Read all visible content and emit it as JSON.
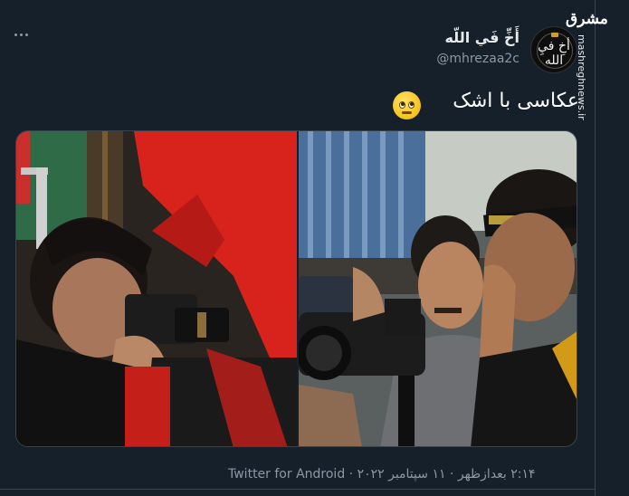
{
  "watermark": {
    "logo_text": "مشرق",
    "url": "mashreghnews.ir"
  },
  "author": {
    "display_name": "أَخِّ فَي اللّه",
    "handle": "@mhrezaa2c",
    "avatar_text": "أخِ فيِ الله"
  },
  "tweet": {
    "text": "عکاسی با اشک",
    "emoji": "pleading-face-emoji"
  },
  "media": {
    "photos": [
      {
        "label": "photographer-crying-left-photo"
      },
      {
        "label": "photographer-wiping-tears-right-photo"
      }
    ]
  },
  "meta": {
    "time": "۲:۱۴ بعدازظهر",
    "separator": "·",
    "date": "۱۱ سپتامبر ۲۰۲۲",
    "source": "Twitter for Android"
  },
  "colors": {
    "background": "#15202b",
    "secondary_text": "#8b98a5",
    "border": "#38444d"
  }
}
